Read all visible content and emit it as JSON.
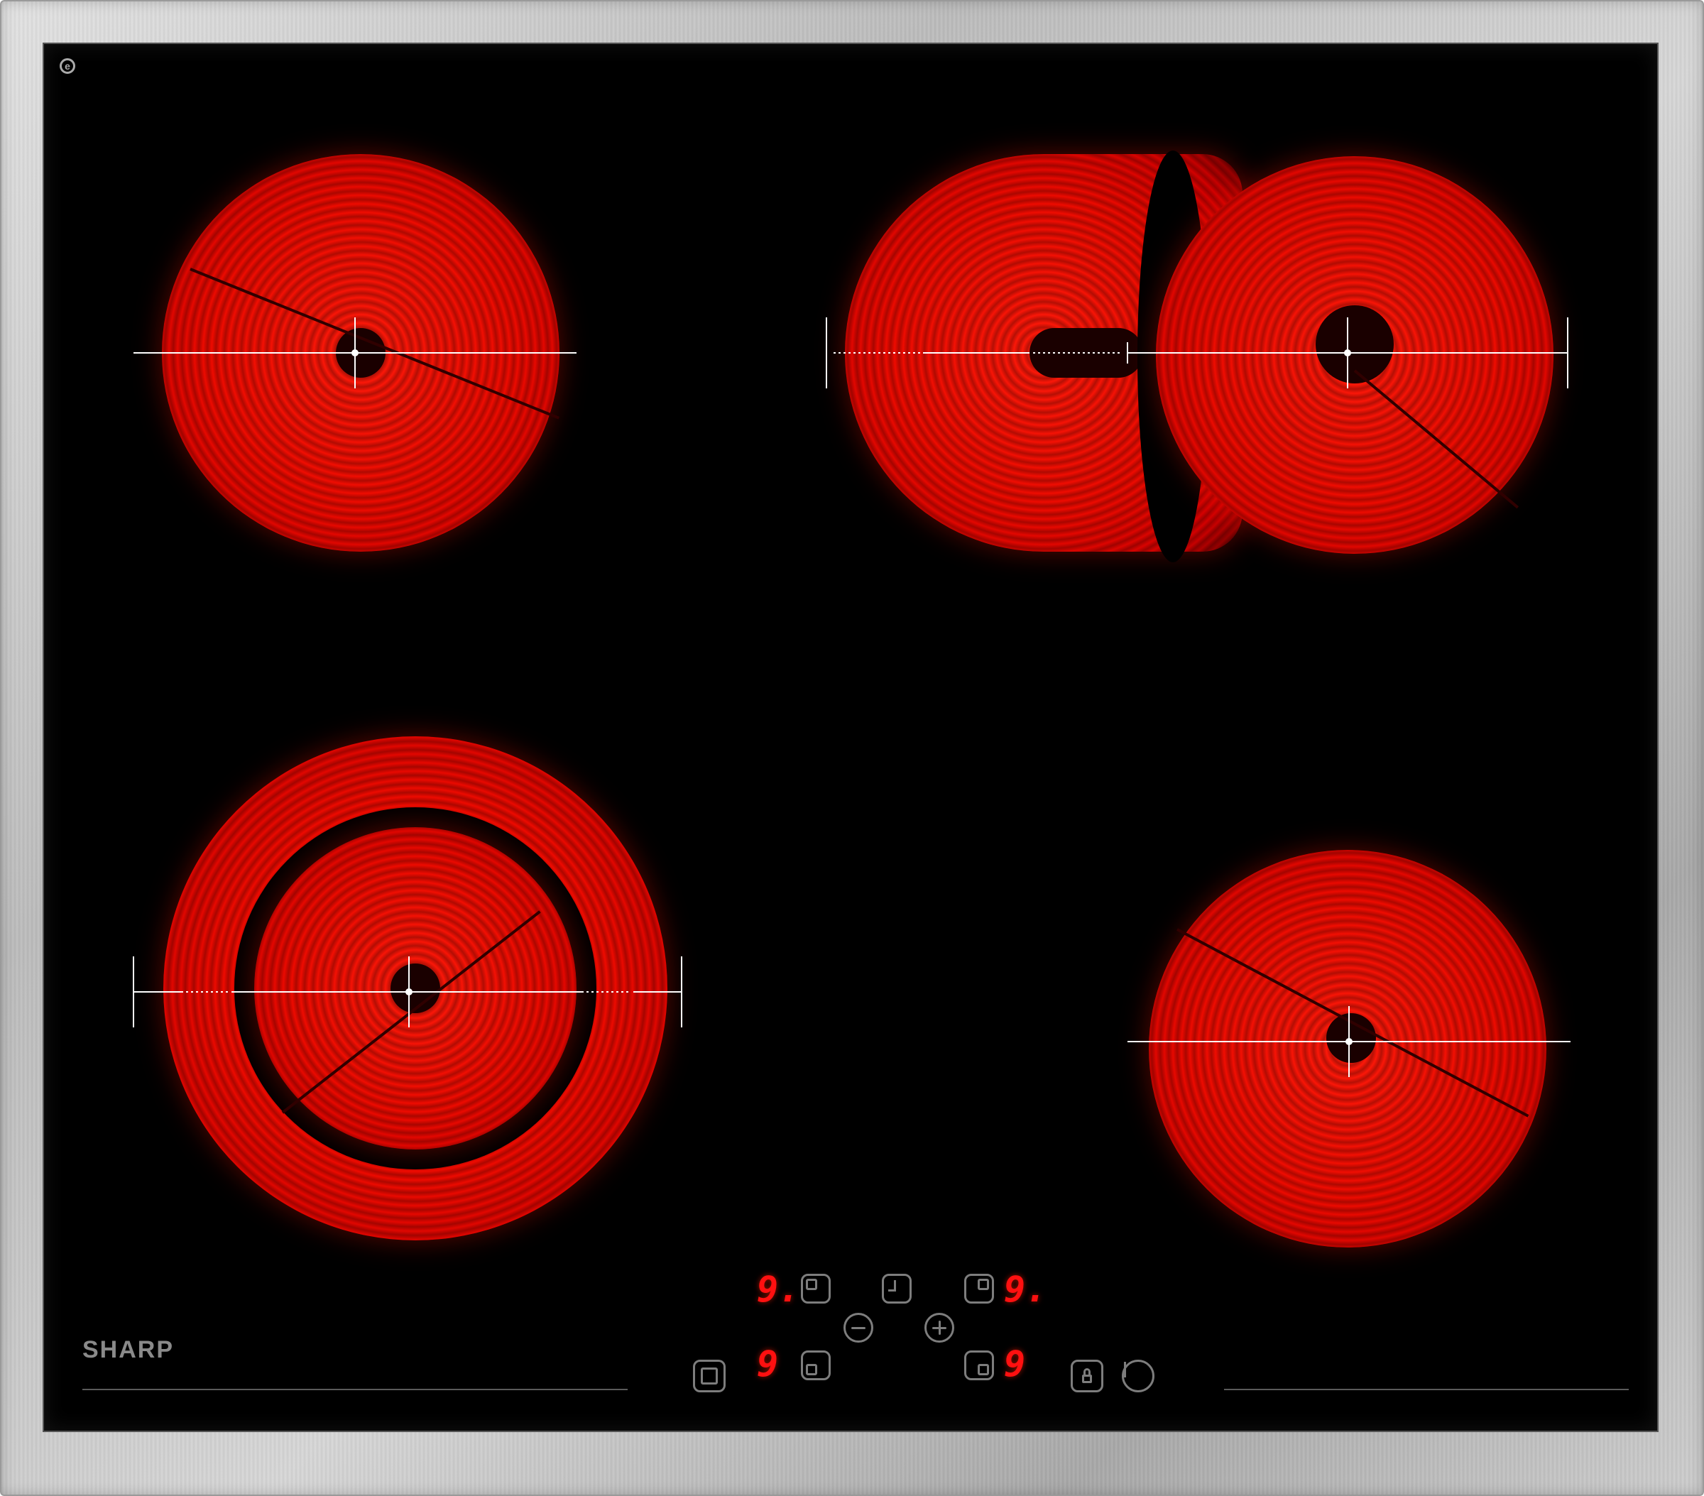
{
  "brand": {
    "name": "SHARP",
    "mark": "e"
  },
  "colors": {
    "glass": "#000000",
    "heat": "#ee0a00",
    "display": "#ff1010",
    "frame": "#c8c8c8",
    "controls": "#7d7d7d"
  },
  "zones": [
    {
      "name": "rear-left",
      "type": "single"
    },
    {
      "name": "rear-right",
      "type": "extended-oval"
    },
    {
      "name": "front-left",
      "type": "dual-ring"
    },
    {
      "name": "front-right",
      "type": "single"
    }
  ],
  "controls": {
    "displays": {
      "rear_left": "9.",
      "rear_right": "9.",
      "front_left": "9",
      "front_right": "9"
    },
    "icons": [
      "rear-left-zone-icon",
      "timer-icon",
      "rear-right-zone-icon",
      "minus-icon",
      "plus-icon",
      "extra-zone-icon",
      "front-left-zone-icon",
      "front-right-zone-icon",
      "lock-icon",
      "power-icon"
    ]
  }
}
